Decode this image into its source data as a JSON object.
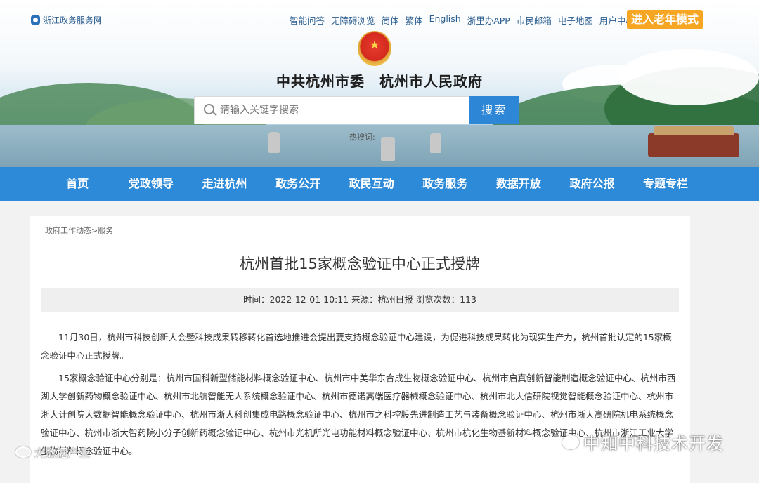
{
  "site": {
    "name": "浙江政务服务网"
  },
  "top_links": [
    "智能问答",
    "无障碍浏览",
    "简体",
    "繁体",
    "English",
    "浙里办APP",
    "市民邮箱",
    "电子地图",
    "用户中心"
  ],
  "elder_mode": "进入老年模式",
  "header": {
    "title": "中共杭州市委　杭州市人民政府"
  },
  "search": {
    "placeholder": "请输入关键字搜索",
    "button": "搜索",
    "hot_label": "热搜词:"
  },
  "nav": [
    "首页",
    "党政领导",
    "走进杭州",
    "政务公开",
    "政民互动",
    "政务服务",
    "数据开放",
    "政府公报",
    "专题专栏"
  ],
  "breadcrumb": {
    "section": "政府工作动态",
    "sep": ">",
    "page": "服务"
  },
  "article": {
    "title": "杭州首批15家概念验证中心正式授牌",
    "meta": "时间：2022-12-01 10:11 来源：杭州日报 浏览次数：113",
    "paragraphs": [
      "11月30日，杭州市科技创新大会暨科技成果转移转化首选地推进会提出要支持概念验证中心建设，为促进科技成果转化为现实生产力，杭州首批认定的15家概念验证中心正式授牌。",
      "15家概念验证中心分别是：杭州市国科新型储能材料概念验证中心、杭州市中美华东合成生物概念验证中心、杭州市启真创新智能制造概念验证中心、杭州市西湖大学创新药物概念验证中心、杭州市北航智能无人系统概念验证中心、杭州市德诺高端医疗器械概念验证中心、杭州市北大信研院视觉智能概念验证中心、杭州市浙大计创院大数据智能概念验证中心、杭州市浙大科创集成电路概念验证中心、杭州市之科控股先进制造工艺与装备概念验证中心、杭州市浙大高研院机电系统概念验证中心、杭州市浙大智药院小分子创新药概念验证中心、杭州市光机所光电功能材料概念验证中心、杭州市杭化生物基新材料概念验证中心、杭州市浙江工业大学生物材料概念验证中心。"
    ]
  },
  "watermarks": {
    "weibo": "大数据产业",
    "wechat": "中知中科技术开发"
  }
}
